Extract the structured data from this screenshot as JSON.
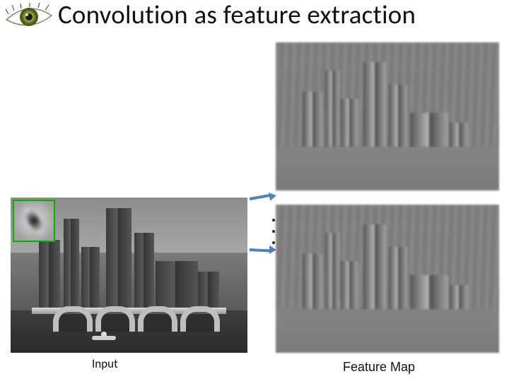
{
  "title": "Convolution as feature extraction",
  "labels": {
    "input": "Input",
    "feature_map": "Feature Map"
  },
  "icons": {
    "logo": "eye-icon",
    "arrow": "arrow-right-icon"
  },
  "layout": {
    "filter_highlight_color": "#00b300",
    "arrow_color": "#4f81bd",
    "feature_map_count_shown": 2
  }
}
